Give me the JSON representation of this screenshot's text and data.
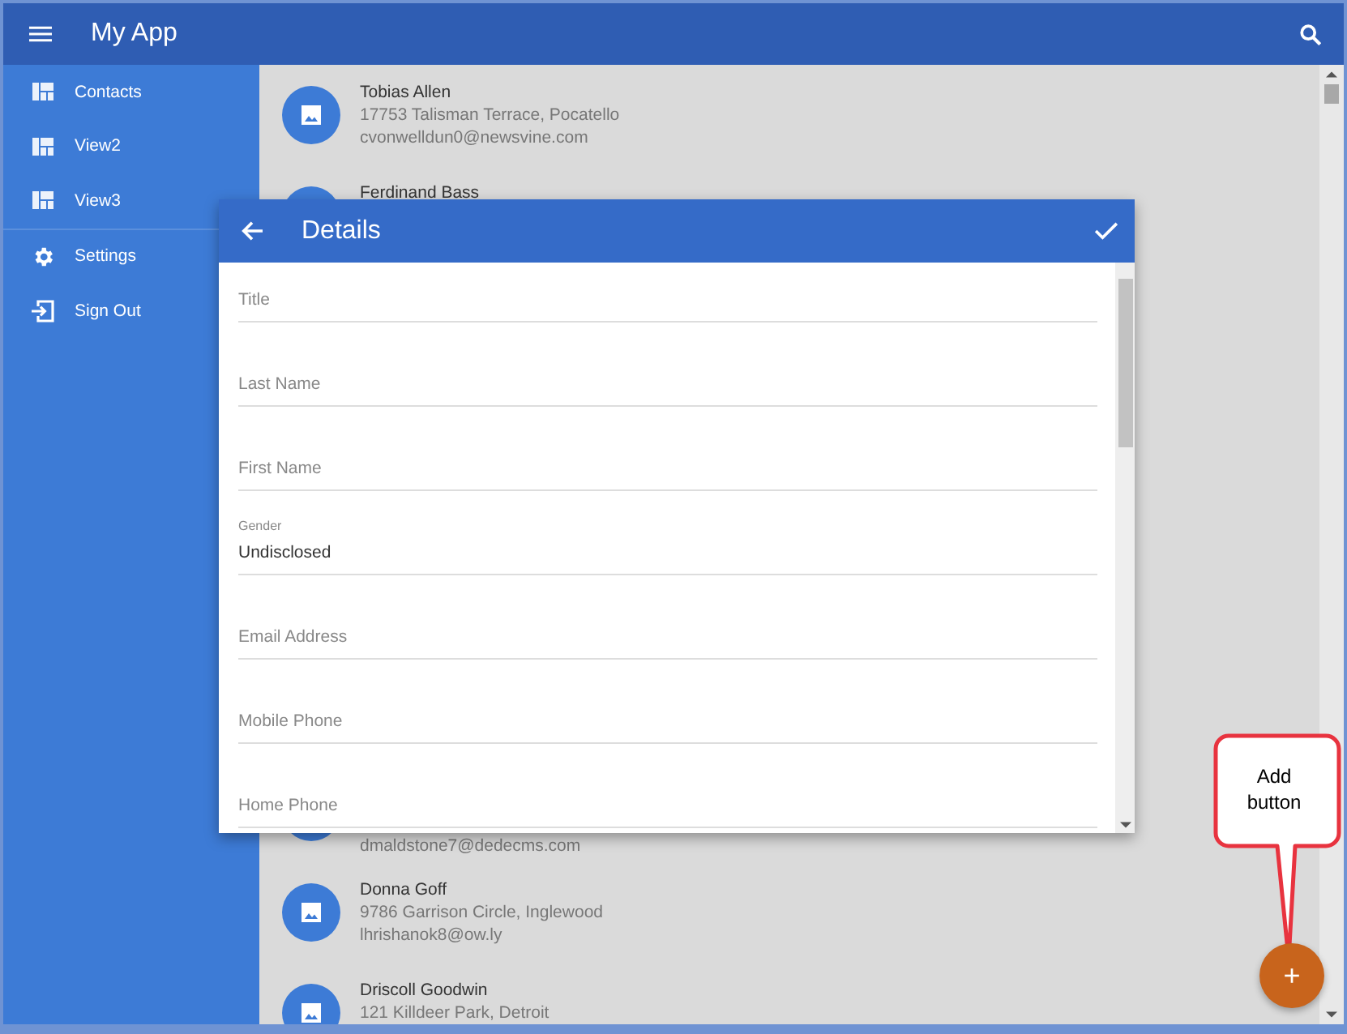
{
  "app_bar": {
    "title": "My App"
  },
  "sidebar": {
    "sections": [
      [
        {
          "label": "Contacts",
          "kind": "view"
        },
        {
          "label": "View2",
          "kind": "view"
        },
        {
          "label": "View3",
          "kind": "view"
        }
      ],
      [
        {
          "label": "Settings",
          "kind": "settings"
        },
        {
          "label": "Sign Out",
          "kind": "signout"
        }
      ]
    ]
  },
  "contacts": {
    "top": [
      {
        "name": "Tobias Allen",
        "address": "17753 Talisman Terrace, Pocatello",
        "email": "cvonwelldun0@newsvine.com"
      },
      {
        "name": "Ferdinand Bass"
      }
    ],
    "bottom": [
      {
        "email": "dmaldstone7@dedecms.com"
      },
      {
        "name": "Donna Goff",
        "address": "9786 Garrison Circle, Inglewood",
        "email": "lhrishanok8@ow.ly"
      },
      {
        "name": "Driscoll Goodwin",
        "address": "121 Killdeer Park, Detroit"
      }
    ]
  },
  "dialog": {
    "title": "Details",
    "fields": [
      {
        "label": "Title"
      },
      {
        "label": "Last Name"
      },
      {
        "label": "First Name"
      },
      {
        "label": "Gender",
        "value": "Undisclosed"
      },
      {
        "label": "Email Address"
      },
      {
        "label": "Mobile Phone"
      },
      {
        "label": "Home Phone"
      }
    ]
  },
  "fab": {
    "label": "+"
  },
  "callout": {
    "text": "Add button"
  }
}
